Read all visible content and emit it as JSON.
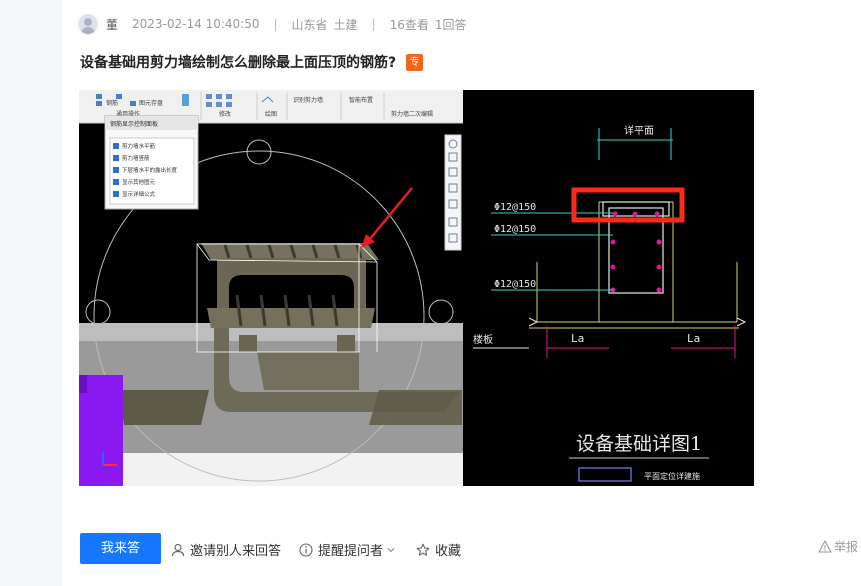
{
  "question": {
    "author": "董",
    "timestamp": "2023-02-14 10:40:50",
    "separator": "|",
    "region": "山东省",
    "category": "土建",
    "views": "16查看",
    "answers": "1回答",
    "title": "设备基础用剪力墙绘制怎么删除最上面压顶的钢筋?",
    "badge": "专"
  },
  "screenshot": {
    "toolbar": {
      "items": [
        "钢筋",
        "图元存盘",
        "通用操作",
        "修改",
        "绘图",
        "识别剪力墙",
        "智能布置",
        "剪力墙二次编辑"
      ]
    },
    "panel": {
      "title": "钢筋显示控制面板",
      "options": [
        "剪力墙水平筋",
        "剪力墙竖筋",
        "下层墙水平的露出长度",
        "显示其他图元",
        "显示详细公式"
      ]
    },
    "drawing": {
      "top_label": "详平面",
      "rebar_labels": [
        "Φ12@150",
        "Φ12@150",
        "Φ12@150"
      ],
      "la_labels": [
        "La",
        "La"
      ],
      "side_label": "楼板",
      "drawing_title": "设备基础详图1",
      "legend_label": "平面定位详建施"
    }
  },
  "actions": {
    "answer": "我来答",
    "invite": "邀请别人来回答",
    "remind": "提醒提问者",
    "favorite": "收藏",
    "report": "举报"
  },
  "colors": {
    "primary": "#1677ff",
    "badge": "#f4661a",
    "highlight": "#ff2a1a",
    "magenta": "#e0139a",
    "purple": "#8a18f0"
  }
}
